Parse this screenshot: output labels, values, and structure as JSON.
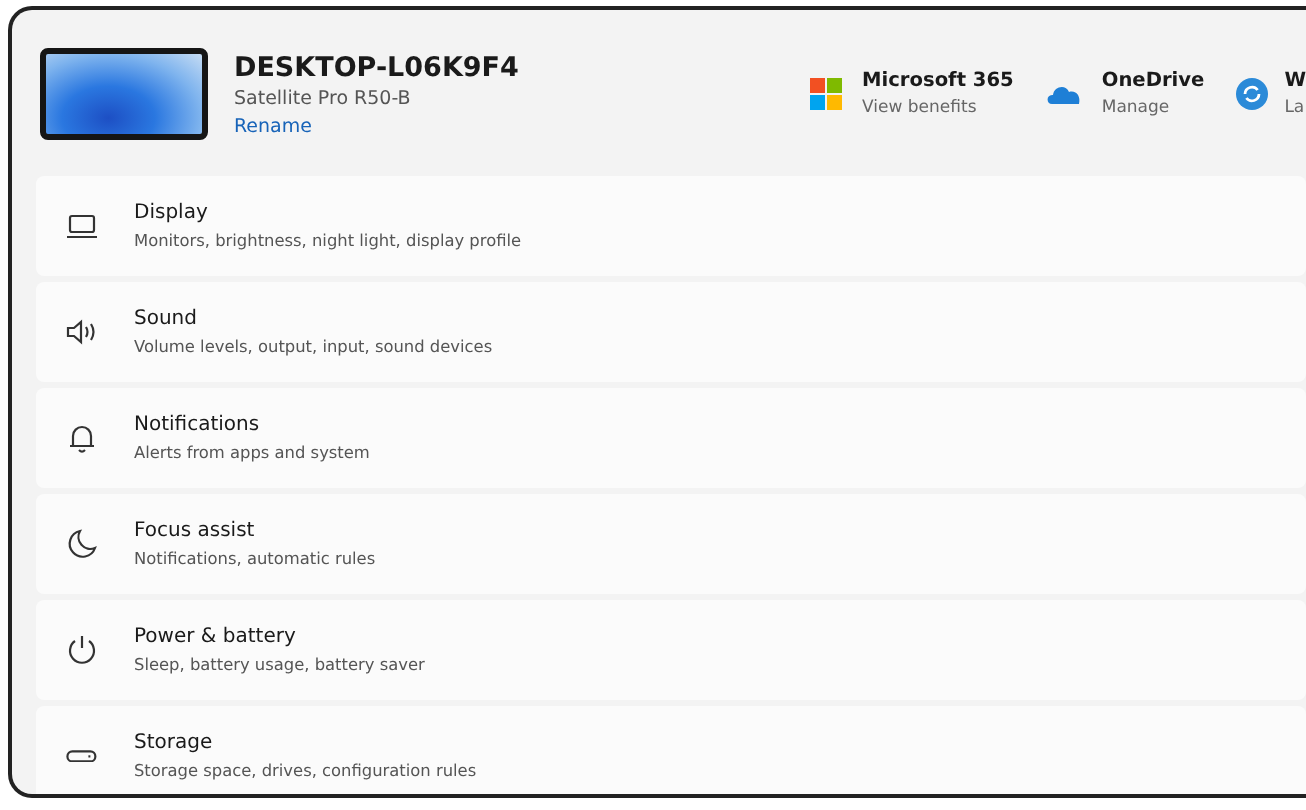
{
  "device": {
    "name": "DESKTOP-L06K9F4",
    "model": "Satellite Pro R50-B",
    "rename": "Rename"
  },
  "services": [
    {
      "title": "Microsoft 365",
      "subtitle": "View benefits"
    },
    {
      "title": "OneDrive",
      "subtitle": "Manage"
    },
    {
      "title": "W",
      "subtitle": "La"
    }
  ],
  "settings": [
    {
      "title": "Display",
      "description": "Monitors, brightness, night light, display profile"
    },
    {
      "title": "Sound",
      "description": "Volume levels, output, input, sound devices"
    },
    {
      "title": "Notifications",
      "description": "Alerts from apps and system"
    },
    {
      "title": "Focus assist",
      "description": "Notifications, automatic rules"
    },
    {
      "title": "Power & battery",
      "description": "Sleep, battery usage, battery saver"
    },
    {
      "title": "Storage",
      "description": "Storage space, drives, configuration rules"
    }
  ]
}
